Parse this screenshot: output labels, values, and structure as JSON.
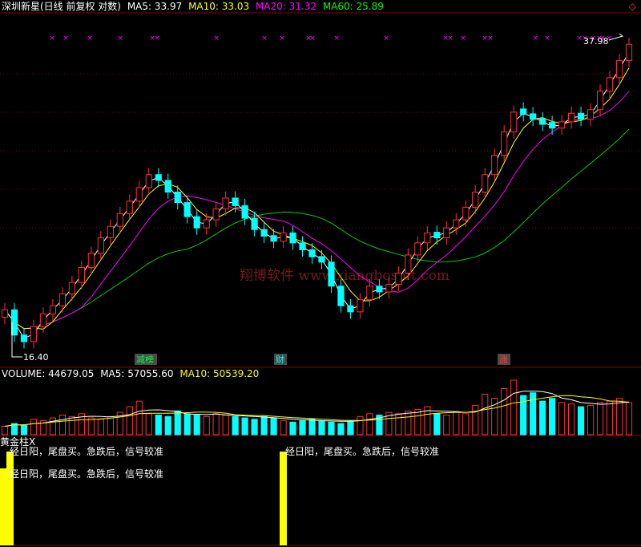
{
  "header": {
    "title": "深圳新星(日线 前复权 对数)",
    "ma5": "MA5: 33.97",
    "ma10": "MA10: 33.03",
    "ma20": "MA20: 31.32",
    "ma60": "MA60: 25.89",
    "diamond": "◇"
  },
  "colors": {
    "up": "#ff3030",
    "down": "#00ffff",
    "ma5": "#ffffff",
    "ma10": "#ffff00",
    "ma20": "#ff00ff",
    "ma60": "#00cc00",
    "grid": "#800000",
    "signal": "#ffff00",
    "marker": "#ff00ff"
  },
  "price_labels": {
    "high": "37.98",
    "low": "16.40"
  },
  "events": [
    "减榜",
    "财",
    "涨"
  ],
  "watermark": "翔博软件 www.xiangbosoft.com",
  "volume_header": {
    "volume": "VOLUME: 44679.05",
    "ma5": "MA5: 57055.60",
    "ma10": "MA10: 50539.20"
  },
  "indicator": {
    "title": "黄金柱X",
    "note_clipped": "经日阳，尾盘买。急跌后，信号较准",
    "note": "经日阳，尾盘买。急跌后，信号较准"
  },
  "chart_data": [
    {
      "type": "candlestick",
      "scale": "log",
      "ylim": [
        16.4,
        37.98
      ],
      "highest": 37.98,
      "lowest": 16.4,
      "ma_latest": {
        "MA5": 33.97,
        "MA10": 33.03,
        "MA20": 31.32,
        "MA60": 25.89
      },
      "close": [
        18.4,
        17.2,
        16.9,
        17.6,
        18.2,
        18.6,
        19.2,
        19.8,
        20.6,
        21.4,
        22.3,
        23.0,
        23.8,
        24.6,
        25.5,
        26.4,
        26.0,
        25.2,
        24.5,
        23.6,
        22.9,
        23.4,
        24.1,
        24.8,
        24.3,
        23.5,
        22.8,
        22.4,
        22.1,
        22.6,
        22.0,
        21.6,
        21.2,
        20.9,
        19.6,
        18.6,
        18.3,
        18.9,
        19.6,
        19.3,
        19.7,
        20.3,
        21.3,
        22.0,
        22.6,
        22.3,
        22.9,
        23.4,
        24.2,
        25.2,
        26.4,
        27.8,
        29.6,
        31.2,
        31.0,
        30.6,
        30.2,
        29.9,
        30.4,
        31.1,
        30.6,
        31.4,
        33.0,
        34.2,
        35.8,
        37.4
      ],
      "up": [
        1,
        0,
        0,
        1,
        1,
        1,
        1,
        1,
        1,
        1,
        1,
        1,
        1,
        1,
        1,
        1,
        0,
        0,
        0,
        0,
        0,
        1,
        1,
        1,
        0,
        0,
        0,
        0,
        0,
        1,
        0,
        0,
        0,
        0,
        0,
        0,
        0,
        1,
        1,
        0,
        1,
        1,
        1,
        1,
        1,
        0,
        1,
        1,
        1,
        1,
        1,
        1,
        1,
        1,
        0,
        0,
        0,
        0,
        1,
        1,
        0,
        1,
        1,
        1,
        1,
        1
      ],
      "signal_markers": 26,
      "events": [
        {
          "label": "减榜",
          "bar": 14
        },
        {
          "label": "财",
          "bar": 37
        },
        {
          "label": "涨",
          "bar": 53
        }
      ]
    },
    {
      "type": "bar",
      "title": "VOLUME",
      "latest": 44679.05,
      "ma_latest": {
        "MA5": 57055.6,
        "MA10": 50539.2
      },
      "values": [
        12,
        16,
        14,
        22,
        20,
        24,
        28,
        26,
        30,
        24,
        22,
        26,
        32,
        40,
        48,
        30,
        28,
        26,
        34,
        30,
        28,
        26,
        30,
        28,
        26,
        24,
        22,
        26,
        24,
        20,
        18,
        20,
        22,
        20,
        18,
        16,
        20,
        26,
        30,
        28,
        32,
        30,
        34,
        36,
        40,
        30,
        28,
        32,
        30,
        42,
        58,
        52,
        66,
        78,
        56,
        60,
        48,
        52,
        46,
        44,
        40,
        42,
        46,
        48,
        52,
        46
      ]
    },
    {
      "type": "bar",
      "title": "黄金柱X",
      "signal_bars": [
        0,
        1,
        30
      ]
    }
  ]
}
